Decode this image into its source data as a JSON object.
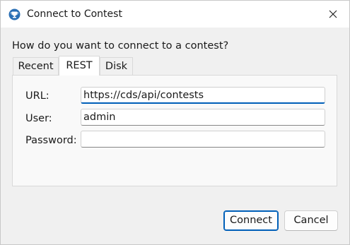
{
  "window": {
    "title": "Connect to Contest",
    "app_icon": "trophy-icon",
    "close_icon": "close-icon"
  },
  "dialog": {
    "question": "How do you want to connect to a contest?",
    "tabs": [
      {
        "label": "Recent",
        "selected": false
      },
      {
        "label": "REST",
        "selected": true
      },
      {
        "label": "Disk",
        "selected": false
      }
    ],
    "fields": {
      "url": {
        "label": "URL:",
        "value": "https://cds/api/contests",
        "focused": true
      },
      "user": {
        "label": "User:",
        "value": "admin"
      },
      "password": {
        "label": "Password:",
        "value": ""
      }
    },
    "buttons": {
      "connect": "Connect",
      "cancel": "Cancel"
    }
  },
  "colors": {
    "accent": "#005fb8",
    "icon_blue": "#2a6fb5"
  }
}
